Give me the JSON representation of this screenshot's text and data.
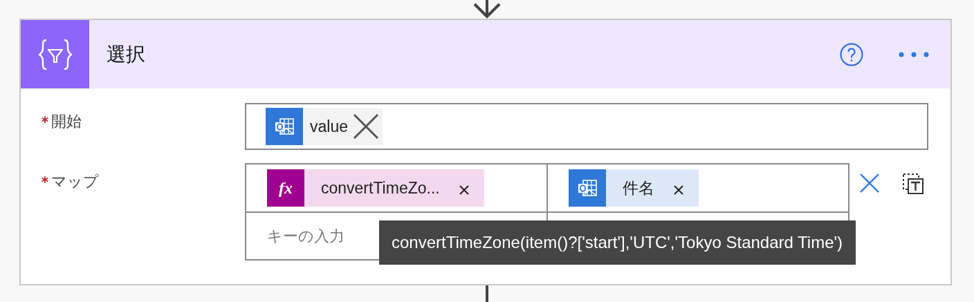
{
  "action": {
    "title": "選択"
  },
  "fields": [
    {
      "label": "開始",
      "required": true,
      "kind": "tokens",
      "tokens": [
        {
          "kind": "outlook",
          "text": "value"
        }
      ]
    },
    {
      "label": "マップ",
      "required": true,
      "kind": "map",
      "rows": [
        {
          "key_token": {
            "kind": "expression",
            "icon_text": "fx",
            "text": "convertTimeZo..."
          },
          "value_token": {
            "kind": "outlook",
            "text": "件名"
          }
        }
      ],
      "key_placeholder": "キーの入力"
    }
  ],
  "tooltip": "convertTimeZone(item()?['start'],'UTC','Tokyo Standard Time')"
}
